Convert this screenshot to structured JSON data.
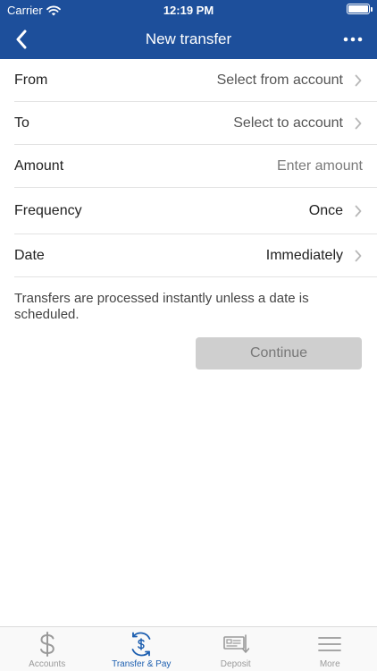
{
  "status_bar": {
    "carrier": "Carrier",
    "time": "12:19 PM"
  },
  "nav": {
    "title": "New transfer",
    "back_icon": "chevron-left-icon",
    "more_icon": "more-horizontal-icon"
  },
  "form": {
    "rows": [
      {
        "label": "From",
        "value": "Select from account"
      },
      {
        "label": "To",
        "value": "Select to account"
      },
      {
        "label": "Amount",
        "placeholder": "Enter amount"
      },
      {
        "label": "Frequency",
        "value": "Once"
      },
      {
        "label": "Date",
        "value": "Immediately"
      }
    ]
  },
  "note": "Transfers are processed instantly unless a date is scheduled.",
  "continue_label": "Continue",
  "tabbar": {
    "tabs": [
      {
        "label": "Accounts",
        "icon": "dollar-icon"
      },
      {
        "label": "Transfer & Pay",
        "icon": "transfer-pay-icon",
        "active": true
      },
      {
        "label": "Deposit",
        "icon": "deposit-check-icon"
      },
      {
        "label": "More",
        "icon": "menu-icon"
      }
    ]
  },
  "colors": {
    "header": "#1d4f9b",
    "active_tab": "#1d5fb0",
    "inactive_tab": "#9a9a9a",
    "button_disabled": "#cfcfcf"
  }
}
